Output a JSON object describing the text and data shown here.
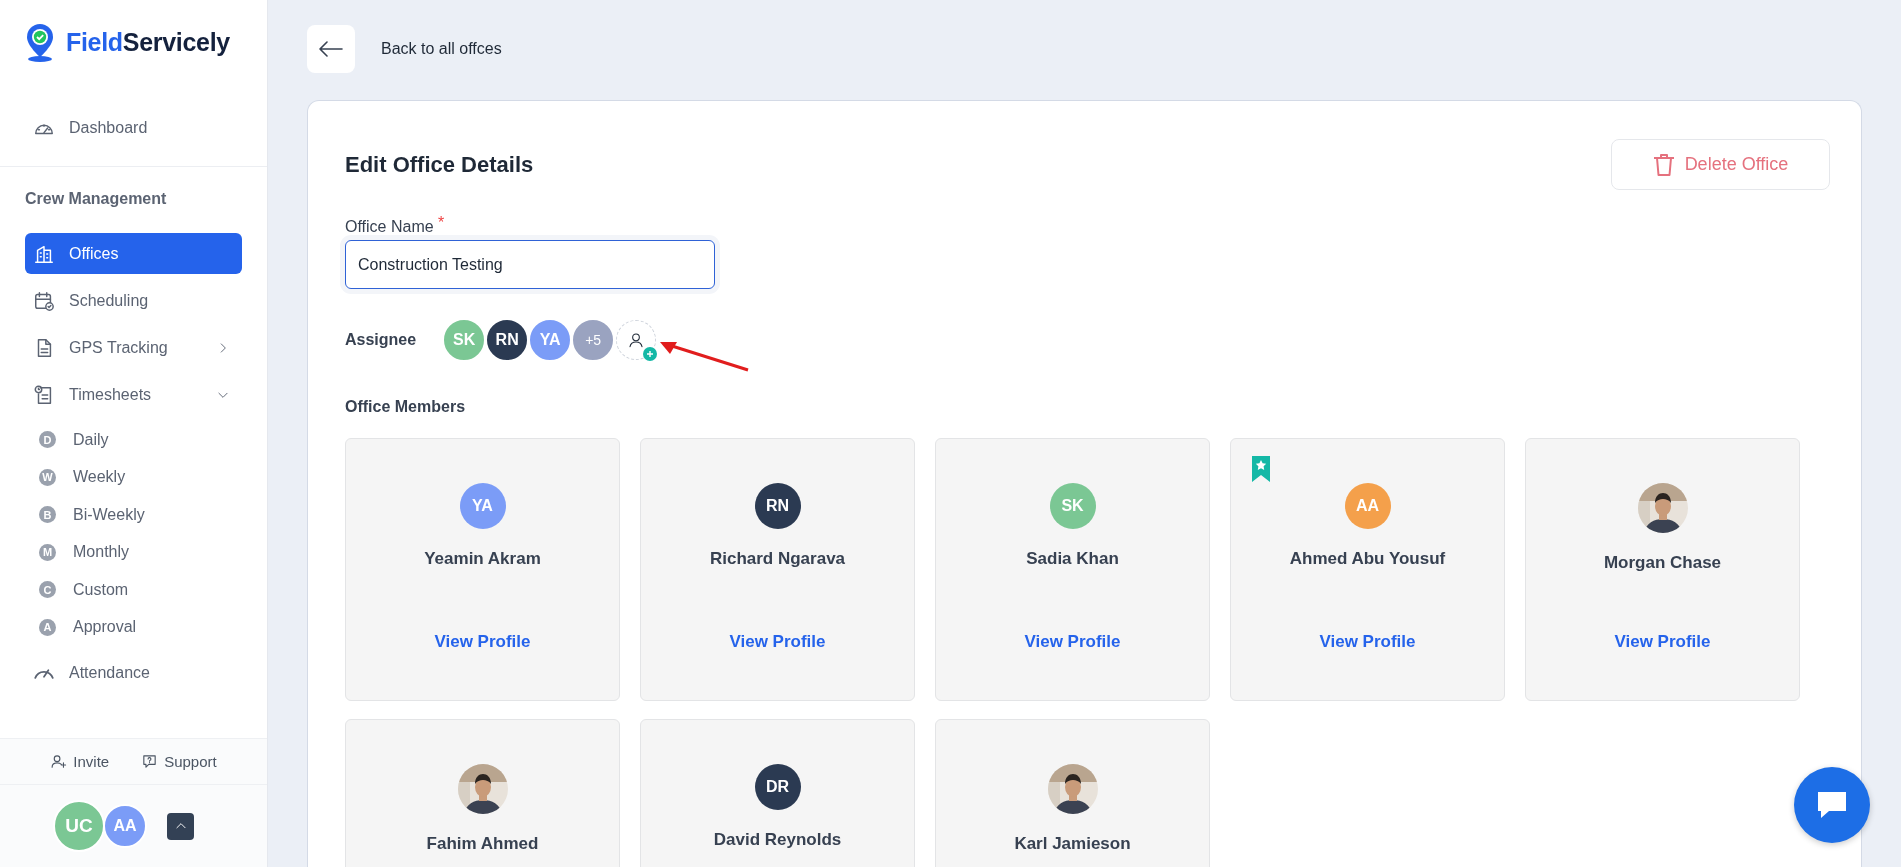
{
  "brand": {
    "first": "Field",
    "second": "Servicely"
  },
  "sidebar": {
    "top_items": [
      {
        "label": "Dashboard",
        "selected": false
      }
    ],
    "section_title": "Crew Management",
    "items": [
      {
        "label": "Offices",
        "selected": true
      },
      {
        "label": "Scheduling",
        "selected": false
      },
      {
        "label": "GPS Tracking",
        "selected": false,
        "expanded": false
      },
      {
        "label": "Timesheets",
        "selected": false,
        "expanded": true,
        "children": [
          {
            "badge": "D",
            "label": "Daily",
            "selected": false
          },
          {
            "badge": "W",
            "label": "Weekly",
            "selected": false
          },
          {
            "badge": "B",
            "label": "Bi-Weekly",
            "selected": false
          },
          {
            "badge": "M",
            "label": "Monthly",
            "selected": false
          },
          {
            "badge": "C",
            "label": "Custom",
            "selected": false
          },
          {
            "badge": "A",
            "label": "Approval",
            "selected": false
          }
        ]
      },
      {
        "label": "Attendance",
        "selected": false
      }
    ],
    "footer_links": [
      {
        "label": "Invite"
      },
      {
        "label": "Support"
      }
    ],
    "users": [
      {
        "initials": "UC",
        "color": "#7bc794"
      },
      {
        "initials": "AA",
        "color": "#7b9cf7"
      }
    ]
  },
  "page": {
    "back_label": "Back to all offces",
    "title": "Edit Office Details",
    "delete_label": "Delete Office",
    "office_name": {
      "label": "Office Name",
      "required_mark": "*",
      "value": "Construction Testing"
    },
    "assignee": {
      "label": "Assignee",
      "avatars": [
        {
          "initials": "SK",
          "color": "#7bc794"
        },
        {
          "initials": "RN",
          "color": "#2b3a52"
        },
        {
          "initials": "YA",
          "color": "#7b9cf7"
        }
      ],
      "more": "+5"
    },
    "members_title": "Office Members",
    "members": [
      {
        "name": "Yeamin Akram",
        "kind": "initials",
        "initials": "YA",
        "color": "#7b9cf7",
        "bookmarked": false,
        "link": "View Profile"
      },
      {
        "name": "Richard Ngarava",
        "kind": "initials",
        "initials": "RN",
        "color": "#2b3a52",
        "bookmarked": false,
        "link": "View Profile"
      },
      {
        "name": "Sadia Khan",
        "kind": "initials",
        "initials": "SK",
        "color": "#7bc794",
        "bookmarked": false,
        "link": "View Profile"
      },
      {
        "name": "Ahmed Abu Yousuf",
        "kind": "initials",
        "initials": "AA",
        "color": "#f4a04b",
        "bookmarked": true,
        "link": "View Profile"
      },
      {
        "name": "Morgan Chase",
        "kind": "picture",
        "bookmarked": false,
        "link": "View Profile"
      },
      {
        "name": "Fahim Ahmed",
        "kind": "picture",
        "bookmarked": false
      },
      {
        "name": "David Reynolds",
        "kind": "initials",
        "initials": "DR",
        "color": "#2b3a52",
        "bookmarked": false
      },
      {
        "name": "Karl Jamieson",
        "kind": "picture",
        "bookmarked": false
      }
    ]
  }
}
